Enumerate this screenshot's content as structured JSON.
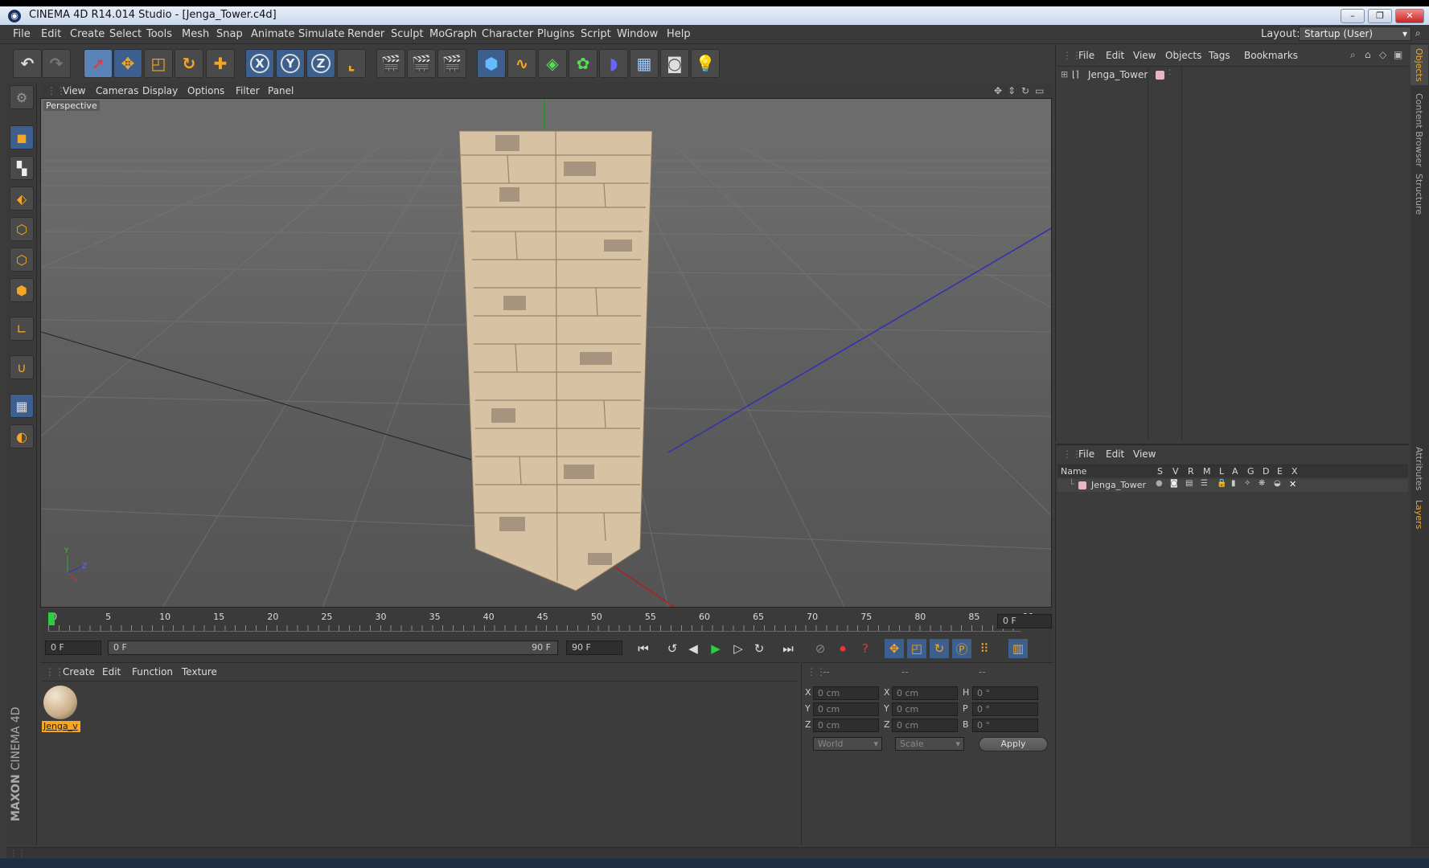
{
  "window": {
    "title": "CINEMA 4D R14.014 Studio - [Jenga_Tower.c4d]",
    "minimize": "–",
    "restore": "❐",
    "close": "✕"
  },
  "menu": [
    "File",
    "Edit",
    "Create",
    "Select",
    "Tools",
    "Mesh",
    "Snap",
    "Animate",
    "Simulate",
    "Render",
    "Sculpt",
    "MoGraph",
    "Character",
    "Plugins",
    "Script",
    "Window",
    "Help"
  ],
  "layout": {
    "label": "Layout:",
    "value": "Startup (User)"
  },
  "axis": {
    "x": "X",
    "y": "Y",
    "z": "Z"
  },
  "viewport": {
    "menu": [
      "View",
      "Cameras",
      "Display",
      "Options",
      "Filter",
      "Panel"
    ],
    "label": "Perspective",
    "gizmo": {
      "y": "Y",
      "z": "Z"
    }
  },
  "timeline": {
    "ticks": [
      "0",
      "5",
      "10",
      "15",
      "20",
      "25",
      "30",
      "35",
      "40",
      "45",
      "50",
      "55",
      "60",
      "65",
      "70",
      "75",
      "80",
      "85",
      "90"
    ],
    "current_frame": "0 F",
    "current_position": 0,
    "start_field": "0 F",
    "range_start": "0 F",
    "range_end": "90 F",
    "end_field": "90 F"
  },
  "materials": {
    "menu": [
      "Create",
      "Edit",
      "Function",
      "Texture"
    ],
    "items": [
      {
        "name": "Jenga_v"
      }
    ]
  },
  "coordinates": {
    "headers": [
      "--",
      "--",
      "--"
    ],
    "rows": [
      {
        "a": "X",
        "av": "0 cm",
        "b": "X",
        "bv": "0 cm",
        "c": "H",
        "cv": "0 °"
      },
      {
        "a": "Y",
        "av": "0 cm",
        "b": "Y",
        "bv": "0 cm",
        "c": "P",
        "cv": "0 °"
      },
      {
        "a": "Z",
        "av": "0 cm",
        "b": "Z",
        "bv": "0 cm",
        "c": "B",
        "cv": "0 °"
      }
    ],
    "mode": "World",
    "transform": "Scale",
    "apply": "Apply"
  },
  "objects": {
    "menu": [
      "File",
      "Edit",
      "View",
      "Objects",
      "Tags",
      "Bookmarks"
    ],
    "items": [
      {
        "name": "Jenga_Tower",
        "color": "#e8b4c8"
      }
    ]
  },
  "layers": {
    "menu": [
      "File",
      "Edit",
      "View"
    ],
    "columns": [
      "Name",
      "S",
      "V",
      "R",
      "M",
      "L",
      "A",
      "G",
      "D",
      "E",
      "X"
    ],
    "items": [
      {
        "name": "Jenga_Tower",
        "color": "#e8b4c8"
      }
    ]
  },
  "sidetabs": [
    "Objects",
    "Content Browser",
    "Structure",
    "Attributes",
    "Layers"
  ],
  "branding": {
    "maxon": "MAXON",
    "cinema": "CINEMA 4D"
  }
}
